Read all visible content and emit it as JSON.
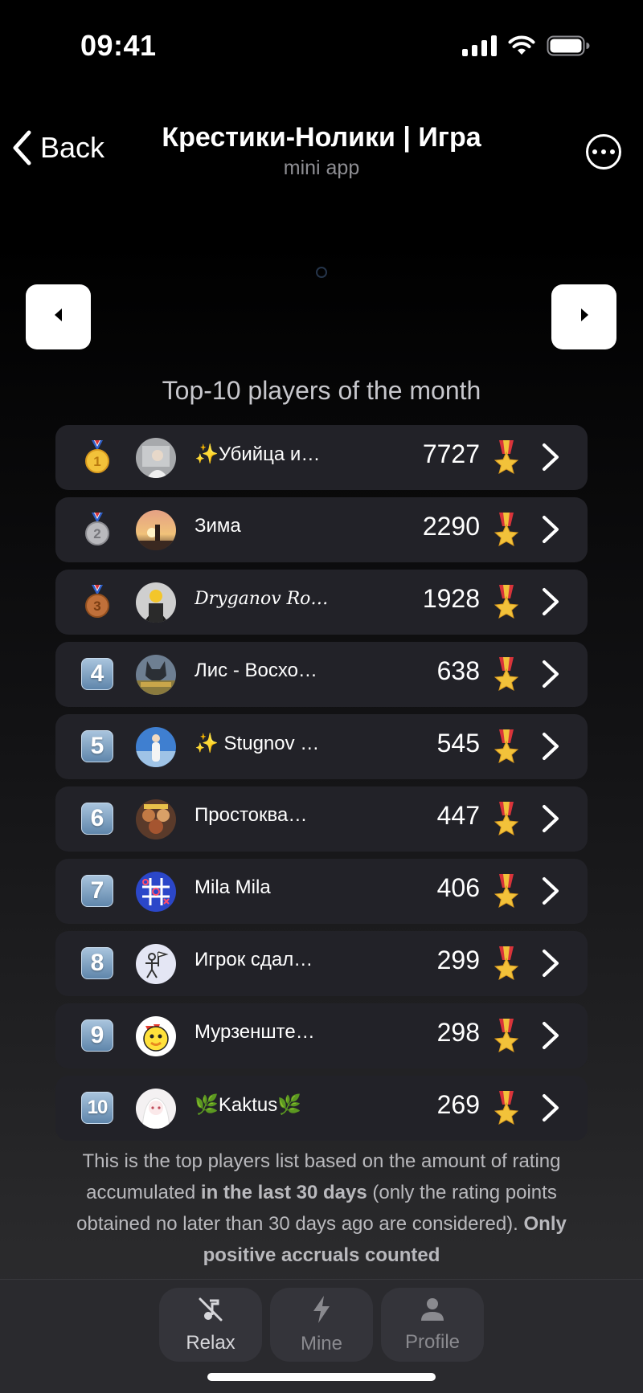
{
  "status_bar": {
    "time": "09:41"
  },
  "header": {
    "back_label": "Back",
    "title": "Крестики-Нолики | Игра",
    "subtitle": "mini app"
  },
  "leaderboard": {
    "title": "Top-10 players of the month",
    "players": [
      {
        "rank": "1",
        "name": "✨Убийца и…",
        "score": "7727"
      },
      {
        "rank": "2",
        "name": "Зима",
        "score": "2290"
      },
      {
        "rank": "3",
        "name": "𝐷𝑟𝑦𝑔𝑎𝑛𝑜𝑣 𝑅𝑜…",
        "score": "1928"
      },
      {
        "rank": "4",
        "name": "Лис - Восхо…",
        "score": "638"
      },
      {
        "rank": "5",
        "name": "✨ Stugnov …",
        "score": "545"
      },
      {
        "rank": "6",
        "name": "Простоква…",
        "score": "447"
      },
      {
        "rank": "7",
        "name": "Mila Mila",
        "score": "406"
      },
      {
        "rank": "8",
        "name": "Игрок сдал…",
        "score": "299"
      },
      {
        "rank": "9",
        "name": "Мурзенште…",
        "score": "298"
      },
      {
        "rank": "10",
        "name": "🌿Kaktus🌿",
        "score": "269"
      }
    ]
  },
  "footnote": {
    "part1": "This is the top players list based on the amount of rating accumulated ",
    "bold1": "in the last 30 days",
    "part2": " (only the rating points obtained no later than 30 days ago are considered). ",
    "bold2": "Only positive accruals counted"
  },
  "bottom_nav": {
    "tabs": [
      {
        "label": "Relax",
        "icon": "music-off-icon"
      },
      {
        "label": "Mine",
        "icon": "lightning-icon"
      },
      {
        "label": "Profile",
        "icon": "person-icon"
      }
    ],
    "active": "Relax"
  },
  "colors": {
    "background": "#000000",
    "row_background": "#222228",
    "nav_background": "#2a2a2e",
    "rank_badge_blue": "#7fa3c6",
    "gold": "#f2c23a",
    "silver": "#b9b9bd",
    "bronze": "#c0703a",
    "medal_ribbon_red": "#d9343a"
  }
}
